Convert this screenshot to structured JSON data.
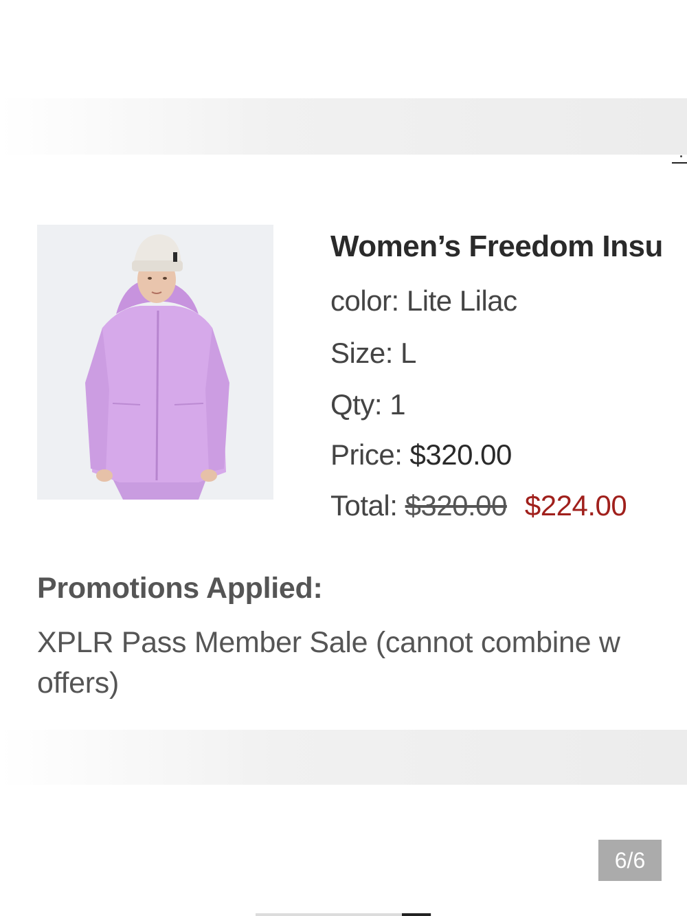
{
  "product": {
    "title": "Women’s Freedom Insu",
    "image_label": "product-photo-jacket",
    "color_label": "color: ",
    "color_value": "Lite Lilac",
    "size_label": "Size: ",
    "size_value": "L",
    "qty_label": "Qty: ",
    "qty_value": "1",
    "price_label": "Price: ",
    "price_value": "$320.00",
    "total_label": "Total: ",
    "total_original": "$320.00",
    "total_sale": "$224.00"
  },
  "promotions": {
    "heading": "Promotions Applied:",
    "line1": "XPLR Pass Member Sale (cannot combine w",
    "line2": "offers)"
  },
  "pager": {
    "counter": "6/6"
  },
  "colors": {
    "sale_price": "#a0201c",
    "jacket": "#d2a6e6",
    "counter_bg": "#ababab"
  }
}
